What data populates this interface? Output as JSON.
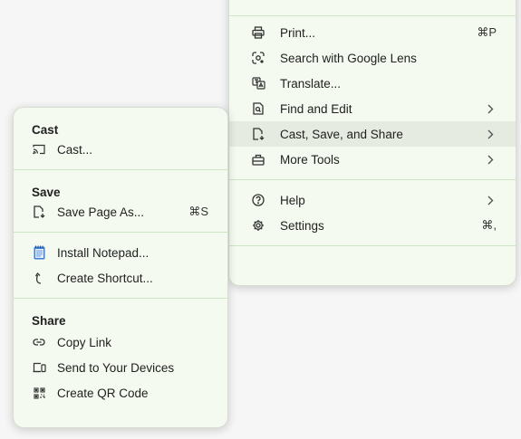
{
  "main_menu": {
    "items": [
      {
        "label": "Print...",
        "shortcut": "⌘P",
        "icon": "printer-icon"
      },
      {
        "label": "Search with Google Lens",
        "icon": "google-lens-icon"
      },
      {
        "label": "Translate...",
        "icon": "translate-icon"
      },
      {
        "label": "Find and Edit",
        "icon": "find-page-icon",
        "submenu": true
      },
      {
        "label": "Cast, Save, and Share",
        "icon": "save-page-icon",
        "submenu": true,
        "highlighted": true
      },
      {
        "label": "More Tools",
        "icon": "toolbox-icon",
        "submenu": true
      },
      {
        "label": "Help",
        "icon": "help-icon",
        "submenu": true
      },
      {
        "label": "Settings",
        "shortcut": "⌘,",
        "icon": "gear-icon"
      }
    ]
  },
  "sub_menu": {
    "cast": {
      "title": "Cast",
      "items": [
        {
          "label": "Cast...",
          "icon": "cast-icon"
        }
      ]
    },
    "save": {
      "title": "Save",
      "items": [
        {
          "label": "Save Page As...",
          "shortcut": "⌘S",
          "icon": "save-page-icon"
        }
      ]
    },
    "install": {
      "items": [
        {
          "label": "Install Notepad...",
          "icon": "notepad-app-icon"
        },
        {
          "label": "Create Shortcut...",
          "icon": "shortcut-arrow-icon"
        }
      ]
    },
    "share": {
      "title": "Share",
      "items": [
        {
          "label": "Copy Link",
          "icon": "link-icon"
        },
        {
          "label": "Send to Your Devices",
          "icon": "devices-icon"
        },
        {
          "label": "Create QR Code",
          "icon": "qr-code-icon"
        }
      ]
    }
  },
  "colors": {
    "menu_bg": "#f5faf0",
    "separator": "#cfe4c4",
    "highlight": "#e6ebe1"
  }
}
